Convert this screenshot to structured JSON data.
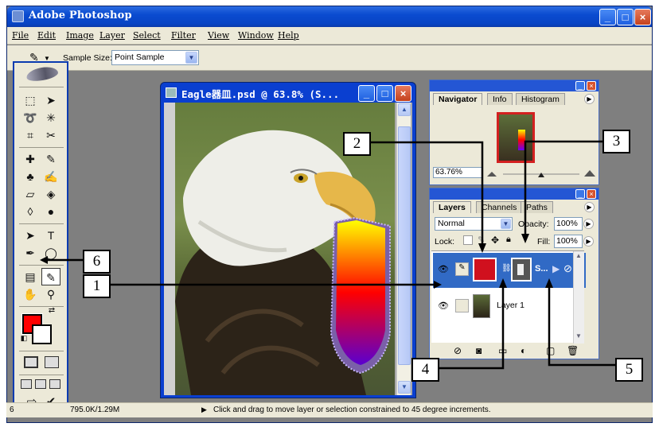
{
  "app": {
    "title": "Adobe Photoshop",
    "window_buttons": [
      "_",
      "□",
      "×"
    ]
  },
  "menu": [
    "File",
    "Edit",
    "Image",
    "Layer",
    "Select",
    "Filter",
    "View",
    "Window",
    "Help"
  ],
  "options_bar": {
    "tool_glyph": "✎",
    "sample_size_label": "Sample Size:",
    "sample_size_value": "Point Sample"
  },
  "document": {
    "title": "Eagle器皿.psd @ 63.8% (S..."
  },
  "navigator": {
    "tabs": [
      "Navigator",
      "Info",
      "Histogram"
    ],
    "active_tab": "Navigator",
    "zoom": "63.76%"
  },
  "layers": {
    "tabs": [
      "Layers",
      "Channels",
      "Paths"
    ],
    "active_tab": "Layers",
    "blend_mode": "Normal",
    "opacity_label": "Opacity:",
    "opacity": "100%",
    "lock_label": "Lock:",
    "fill_label": "Fill:",
    "fill": "100%",
    "items": [
      {
        "name": "S...",
        "selected": true
      },
      {
        "name": "Layer 1",
        "selected": false
      }
    ]
  },
  "callouts": [
    "2",
    "3",
    "6",
    "1",
    "4",
    "5"
  ],
  "status": {
    "doc_size": "795.0K/1.29M",
    "left_cell": "6",
    "hint": "Click and drag to move layer or selection constrained to 45 degree increments."
  },
  "colors": {
    "foreground": "#ff0000",
    "background": "#ffffff",
    "xp_blue": "#0a4bd0"
  }
}
